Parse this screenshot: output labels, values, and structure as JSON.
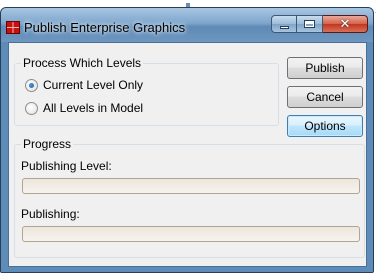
{
  "window": {
    "title": "Publish Enterprise Graphics",
    "app_icon": "app-icon",
    "caption_buttons": {
      "minimize": "minimize-icon",
      "maximize": "maximize-icon",
      "close": "close-icon",
      "close_glyph": "✕"
    }
  },
  "process_group": {
    "label": "Process Which Levels",
    "options": [
      {
        "label": "Current Level Only",
        "checked": true
      },
      {
        "label": "All Levels in Model",
        "checked": false
      }
    ]
  },
  "buttons": {
    "publish": "Publish",
    "cancel": "Cancel",
    "options": "Options"
  },
  "progress_group": {
    "label": "Progress",
    "publishing_level_label": "Publishing Level:",
    "publishing_level_value": 0,
    "publishing_label": "Publishing:",
    "publishing_value": 0
  }
}
